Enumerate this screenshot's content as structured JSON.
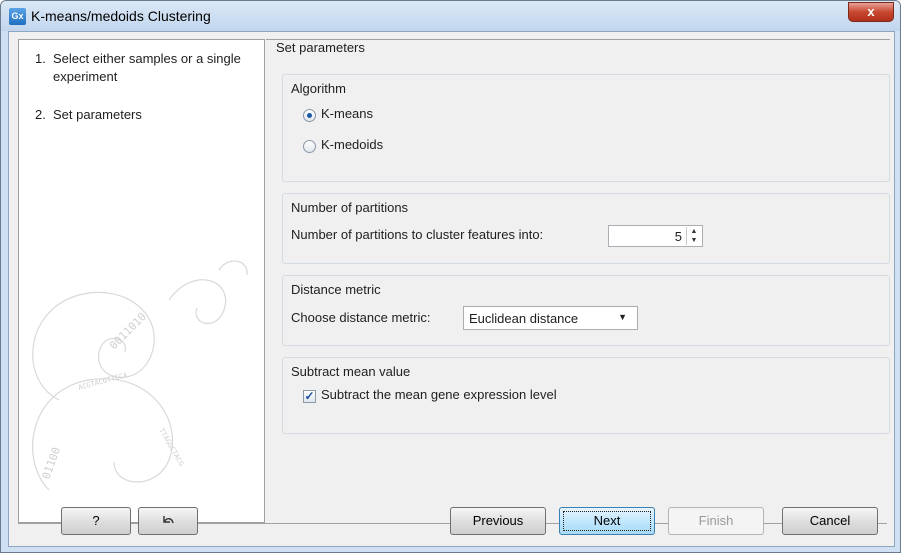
{
  "window": {
    "title": "K-means/medoids Clustering",
    "app_icon_text": "Gx",
    "close_label": "x"
  },
  "steps": [
    {
      "num": "1.",
      "label": "Select either samples or a single experiment"
    },
    {
      "num": "2.",
      "label": "Set parameters"
    }
  ],
  "header": "Set parameters",
  "algorithm": {
    "title": "Algorithm",
    "options": [
      {
        "label": "K-means",
        "selected": true
      },
      {
        "label": "K-medoids",
        "selected": false
      }
    ]
  },
  "partitions": {
    "title": "Number of partitions",
    "label": "Number of partitions to cluster features into:",
    "value": "5"
  },
  "distance": {
    "title": "Distance metric",
    "label": "Choose distance metric:",
    "value": "Euclidean distance"
  },
  "subtract": {
    "title": "Subtract mean value",
    "label": "Subtract the mean gene expression level",
    "checked": true
  },
  "buttons": {
    "help": "?",
    "previous": "Previous",
    "next": "Next",
    "finish": "Finish",
    "cancel": "Cancel"
  }
}
